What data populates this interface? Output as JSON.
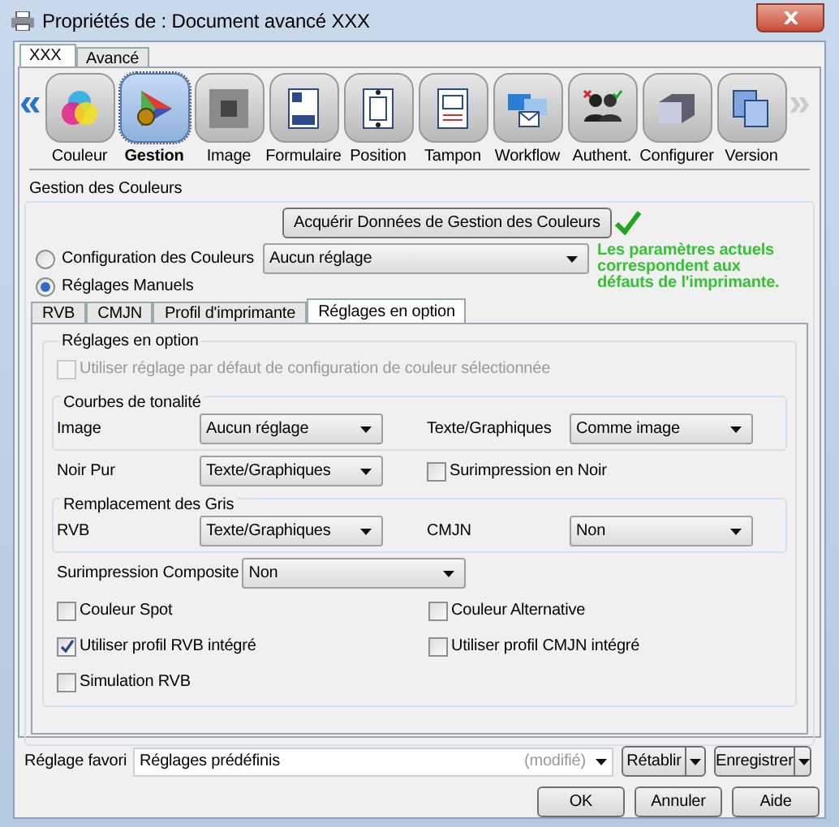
{
  "window": {
    "title": "Propriétés de : Document avancé XXX"
  },
  "outer_tabs": [
    {
      "label": "XXX",
      "selected": true
    },
    {
      "label": "Avancé",
      "selected": false
    }
  ],
  "nav": {
    "prev": {
      "label": "«",
      "disabled": false
    },
    "next": {
      "label": "»",
      "disabled": true
    }
  },
  "toolbar": [
    {
      "label": "Couleur",
      "selected": false
    },
    {
      "label": "Gestion",
      "selected": true
    },
    {
      "label": "Image",
      "selected": false
    },
    {
      "label": "Formulaire",
      "selected": false
    },
    {
      "label": "Position",
      "selected": false
    },
    {
      "label": "Tampon",
      "selected": false
    },
    {
      "label": "Workflow",
      "selected": false
    },
    {
      "label": "Authent.",
      "selected": false
    },
    {
      "label": "Configurer",
      "selected": false
    },
    {
      "label": "Version",
      "selected": false
    }
  ],
  "color_management": {
    "title": "Gestion des Couleurs",
    "acquire_button": "Acquérir Données de Gestion des Couleurs",
    "acquired": true,
    "modes": [
      {
        "label": "Configuration des Couleurs",
        "selected": false
      },
      {
        "label": "Réglages Manuels",
        "selected": true
      }
    ],
    "configuration_value": "Aucun réglage",
    "status": "Les paramètres actuels correspondent aux défauts de l'imprimante."
  },
  "sub_tabs": [
    {
      "label": "RVB",
      "selected": false
    },
    {
      "label": "CMJN",
      "selected": false
    },
    {
      "label": "Profil d'imprimante",
      "selected": false
    },
    {
      "label": "Réglages en option",
      "selected": true
    }
  ],
  "optional_settings": {
    "title": "Réglages en option",
    "use_default": {
      "label": "Utiliser réglage par défaut de configuration de couleur sélectionnée",
      "checked": false,
      "disabled": true
    },
    "tone_curves": {
      "title": "Courbes de tonalité",
      "fields": [
        {
          "label": "Image",
          "value": "Aucun réglage"
        },
        {
          "label": "Texte/Graphiques",
          "value": "Comme image"
        }
      ]
    },
    "pure_black": {
      "label": "Noir Pur",
      "value": "Texte/Graphiques"
    },
    "black_overprint": {
      "label": "Surimpression en Noir",
      "checked": false
    },
    "gray_replacement": {
      "title": "Remplacement des Gris",
      "fields": [
        {
          "label": "RVB",
          "value": "Texte/Graphiques"
        },
        {
          "label": "CMJN",
          "value": "Non"
        }
      ]
    },
    "composite_overprint": {
      "label": "Surimpression Composite",
      "value": "Non"
    },
    "checkboxes": [
      {
        "label": "Couleur Spot",
        "checked": false
      },
      {
        "label": "Couleur Alternative",
        "checked": false
      },
      {
        "label": "Utiliser profil RVB intégré",
        "checked": true
      },
      {
        "label": "Utiliser profil CMJN intégré",
        "checked": false
      },
      {
        "label": "Simulation RVB",
        "checked": false
      }
    ]
  },
  "favorite": {
    "label": "Réglage favori",
    "value": "Réglages prédéfinis",
    "note": "(modifié)",
    "buttons": [
      "Rétablir",
      "Enregistrer"
    ]
  },
  "dialog_buttons": [
    "OK",
    "Annuler",
    "Aide"
  ]
}
